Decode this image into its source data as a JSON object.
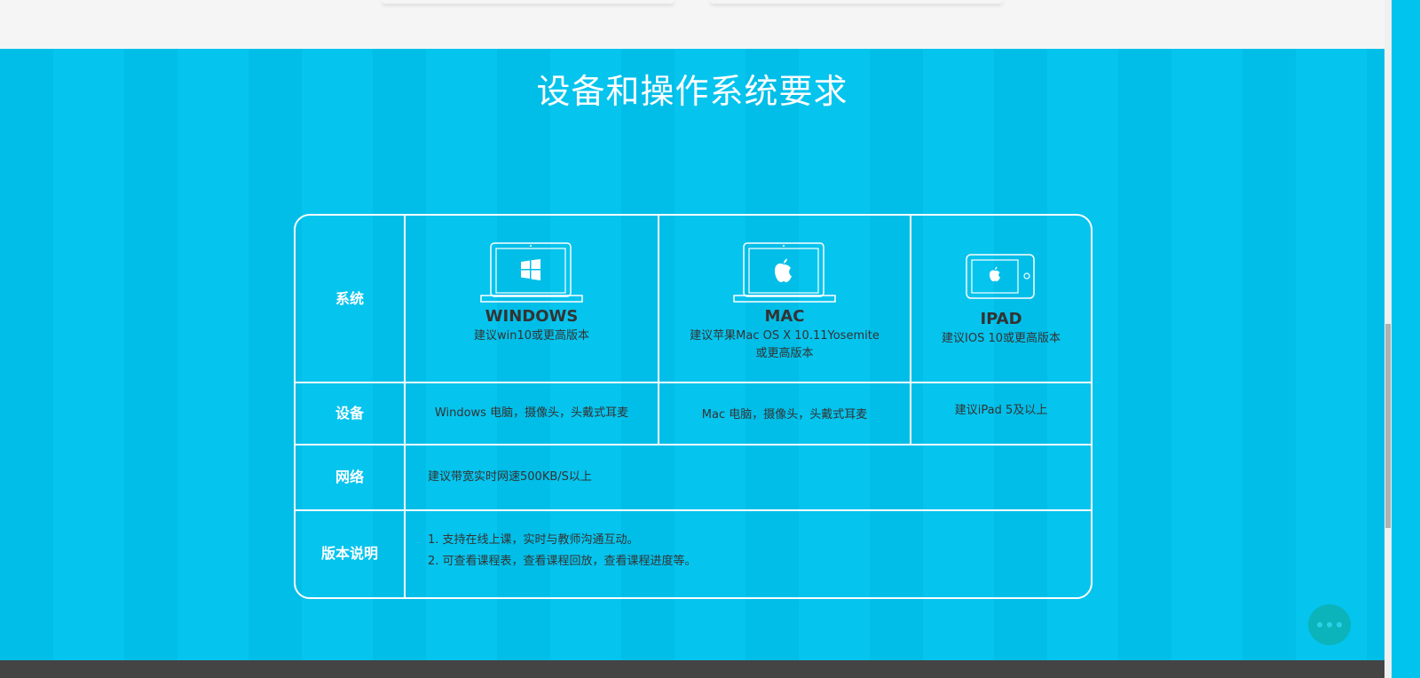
{
  "section": {
    "title": "设备和操作系统要求"
  },
  "table": {
    "row_labels": [
      "系统",
      "设备",
      "网络",
      "版本说明"
    ],
    "systems": [
      {
        "name": "WINDOWS",
        "desc": "建议win10或更高版本",
        "device": "Windows 电脑，摄像头，头戴式耳麦",
        "icon": "windows-laptop-icon"
      },
      {
        "name": "MAC",
        "desc": "建议苹果Mac OS X 10.11Yosemite",
        "desc2": "或更高版本",
        "device": "Mac 电脑，摄像头，头戴式耳麦",
        "icon": "mac-laptop-icon"
      },
      {
        "name": "IPAD",
        "desc": "建议IOS 10或更高版本",
        "device": "建议iPad 5及以上",
        "icon": "ipad-icon"
      }
    ],
    "network": "建议带宽实时网速500KB/S以上",
    "notes": [
      "1. 支持在线上课，实时与教师沟通互动。",
      "2. 可查看课程表，查看课程回放，查看课程进度等。"
    ]
  },
  "colors": {
    "background": "#00c3ee",
    "text": "#333333",
    "chat": "#0bb3bb"
  }
}
